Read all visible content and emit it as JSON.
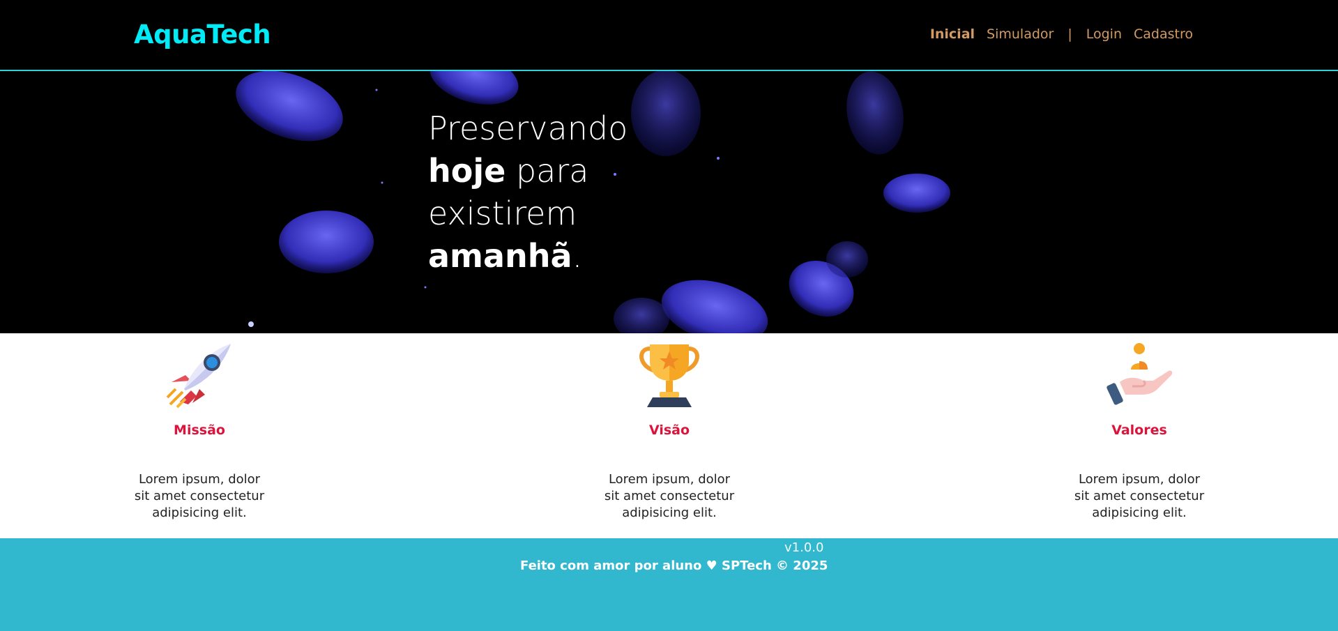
{
  "header": {
    "logo": "AquaTech",
    "nav": {
      "home": "Inicial",
      "simulator": "Simulador",
      "separator": "|",
      "login": "Login",
      "signup": "Cadastro"
    }
  },
  "hero": {
    "line1": "Preservando",
    "line2_bold": "hoje",
    "line2_rest": " para",
    "line3": "existirem",
    "line4_bold": "amanhã",
    "line4_rest": "."
  },
  "cards": [
    {
      "icon": "rocket-icon",
      "title": "Missão",
      "text": "Lorem ipsum, dolor sit amet consectetur adipisicing elit."
    },
    {
      "icon": "trophy-icon",
      "title": "Visão",
      "text": "Lorem ipsum, dolor sit amet consectetur adipisicing elit."
    },
    {
      "icon": "hand-person-icon",
      "title": "Valores",
      "text": "Lorem ipsum, dolor sit amet consectetur adipisicing elit."
    }
  ],
  "footer": {
    "version": "v1.0.0",
    "credit": "Feito com amor por aluno ♥ SPTech © 2025"
  },
  "colors": {
    "logo": "#00ebf5",
    "nav": "#d39b63",
    "card_title": "#dc143c",
    "footer_bg": "#32b8ce",
    "header_border": "#2fd3e0",
    "jellyfish": "#4a47e6"
  }
}
